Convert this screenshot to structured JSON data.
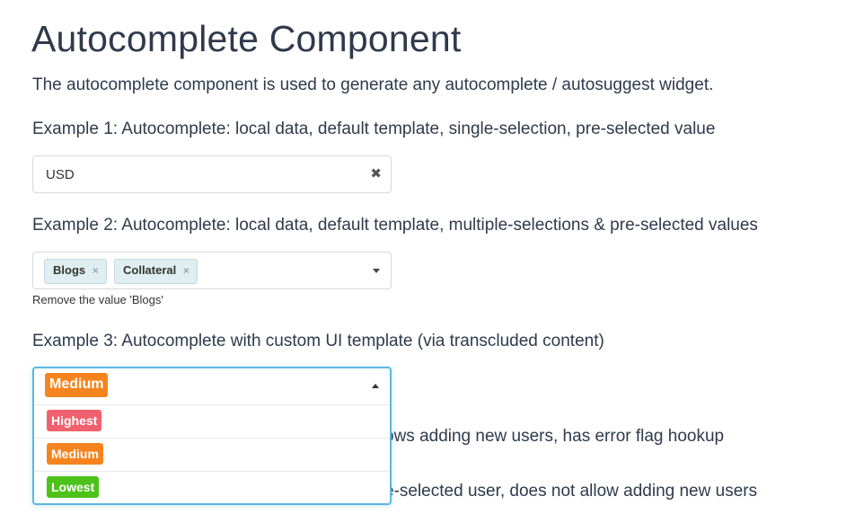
{
  "page": {
    "title": "Autocomplete Component",
    "description": "The autocomplete component is used to generate any autocomplete / autosuggest widget."
  },
  "example1": {
    "label": "Example 1: Autocomplete: local data, default template, single-selection, pre-selected value",
    "value": "USD",
    "clear_icon": "close-icon"
  },
  "example2": {
    "label": "Example 2: Autocomplete: local data, default template, multiple-selections & pre-selected values",
    "tags": [
      {
        "label": "Blogs"
      },
      {
        "label": "Collateral"
      }
    ],
    "hint": "Remove the value 'Blogs'"
  },
  "example3": {
    "label": "Example 3: Autocomplete with custom UI template (via transcluded content)",
    "selected": {
      "label": "Medium",
      "color": "#f5841f"
    },
    "options": [
      {
        "label": "Highest",
        "color": "#f0616d"
      },
      {
        "label": "Medium",
        "color": "#f5841f"
      },
      {
        "label": "Lowest",
        "color": "#4cc21a"
      }
    ]
  },
  "example4": {
    "label_fragment": "ows adding new users, has error flag hookup"
  },
  "example5": {
    "label_fragment": "e-selected user, does not allow adding new users"
  },
  "icons": {
    "remove_tag": "×",
    "clear": "✖"
  }
}
